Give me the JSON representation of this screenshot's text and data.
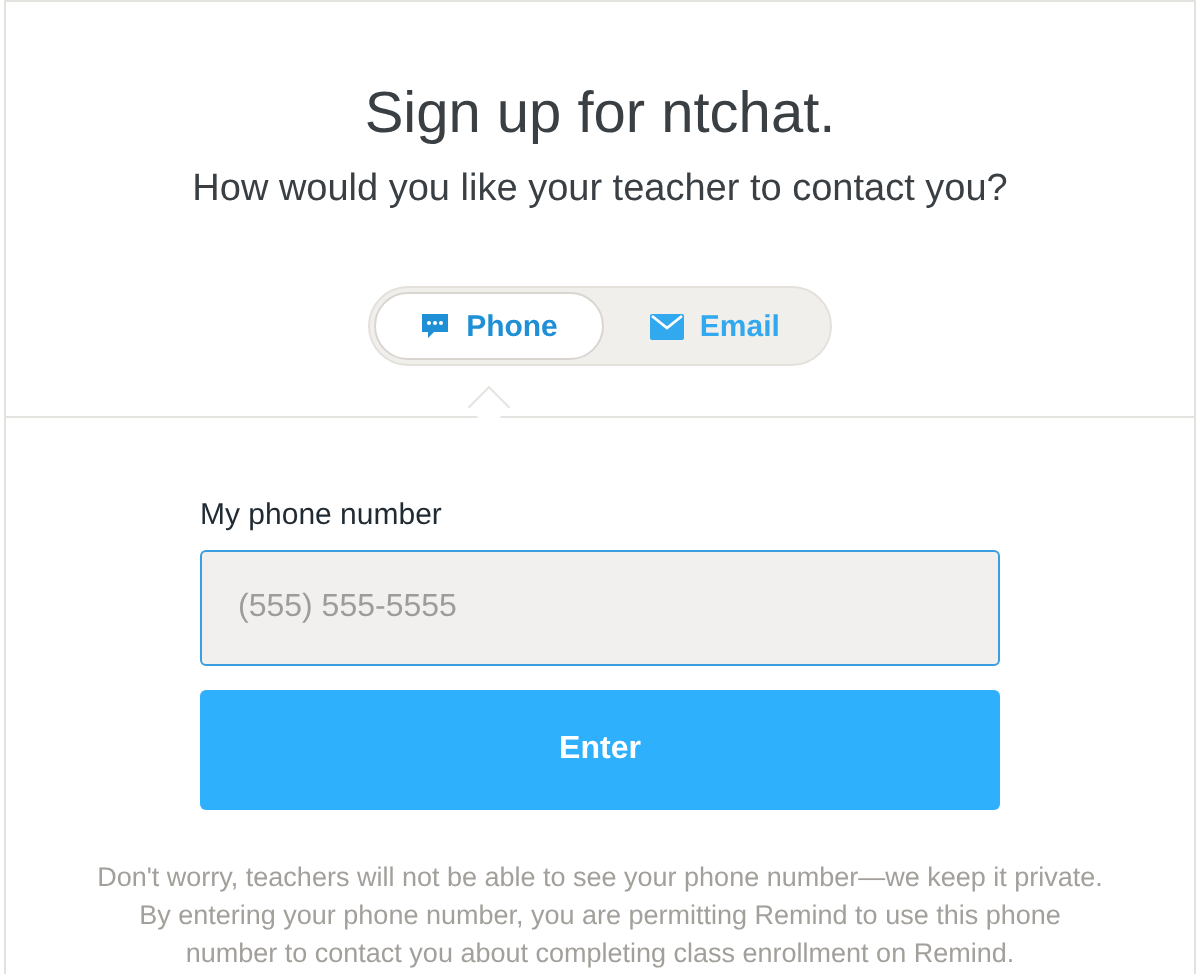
{
  "title": "Sign up for ntchat.",
  "subtitle": "How would you like your teacher to contact you?",
  "tabs": [
    {
      "kind": "phone",
      "label": "Phone",
      "selected": true
    },
    {
      "kind": "email",
      "label": "Email",
      "selected": false
    }
  ],
  "field": {
    "label": "My phone number",
    "placeholder": "(555) 555-5555"
  },
  "button": "Enter",
  "notice": [
    "Don't worry, teachers will not be able to see your phone number—we keep it private.",
    "By entering your phone number, you are permitting Remind to use this phone number to contact you about completing class enrollment on Remind."
  ]
}
